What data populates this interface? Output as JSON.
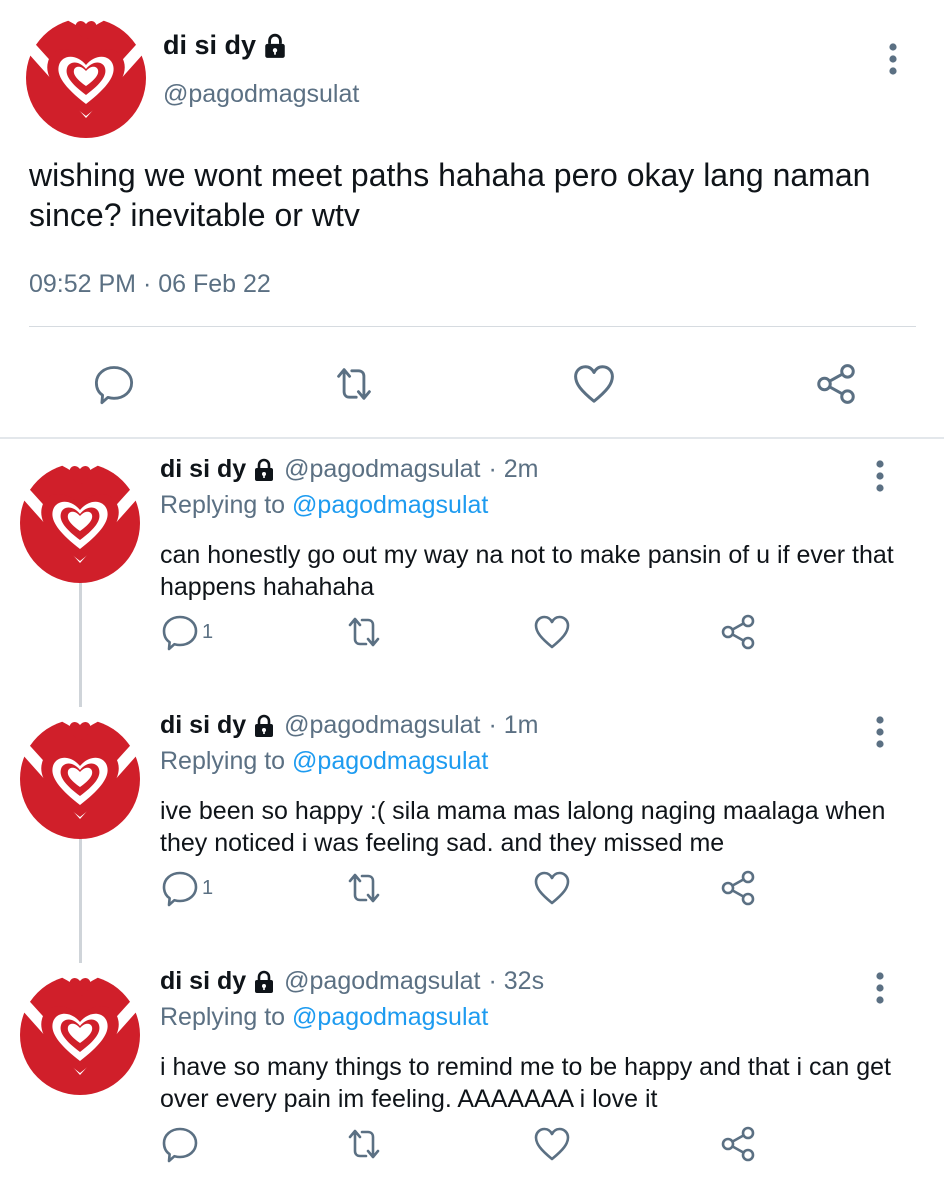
{
  "main_tweet": {
    "display_name": "di si dy",
    "handle": "@pagodmagsulat",
    "text": "wishing we wont meet paths hahaha pero okay lang naman since? inevitable or wtv",
    "timestamp": "09:52 PM · 06 Feb 22"
  },
  "replies": [
    {
      "display_name": "di si dy",
      "handle": "@pagodmagsulat",
      "time": "· 2m",
      "replying_prefix": "Replying to",
      "replying_to": "@pagodmagsulat",
      "text": "can honestly go out my way na not to make pansin of u if ever that happens hahahaha",
      "reply_count": "1"
    },
    {
      "display_name": "di si dy",
      "handle": "@pagodmagsulat",
      "time": "· 1m",
      "replying_prefix": "Replying to",
      "replying_to": "@pagodmagsulat",
      "text": "ive been so happy :( sila mama mas lalong naging maalaga when they noticed i was feeling sad. and they missed me",
      "reply_count": "1"
    },
    {
      "display_name": "di si dy",
      "handle": "@pagodmagsulat",
      "time": "· 32s",
      "replying_prefix": "Replying to",
      "replying_to": "@pagodmagsulat",
      "text": "i have so many things to remind me to be happy and that i can get over every pain im feeling. AAAAAAA i love it",
      "reply_count": ""
    }
  ],
  "icons": {
    "lock": "lock-icon",
    "more": "more-vertical-icon",
    "reply": "reply-bubble-icon",
    "retweet": "retweet-icon",
    "like": "heart-icon",
    "share": "share-icon"
  },
  "colors": {
    "avatar_red": "#d01f2a",
    "mention_blue": "#1d9bf0",
    "secondary_text": "#5b7083",
    "icon_gray": "#5b7083"
  }
}
